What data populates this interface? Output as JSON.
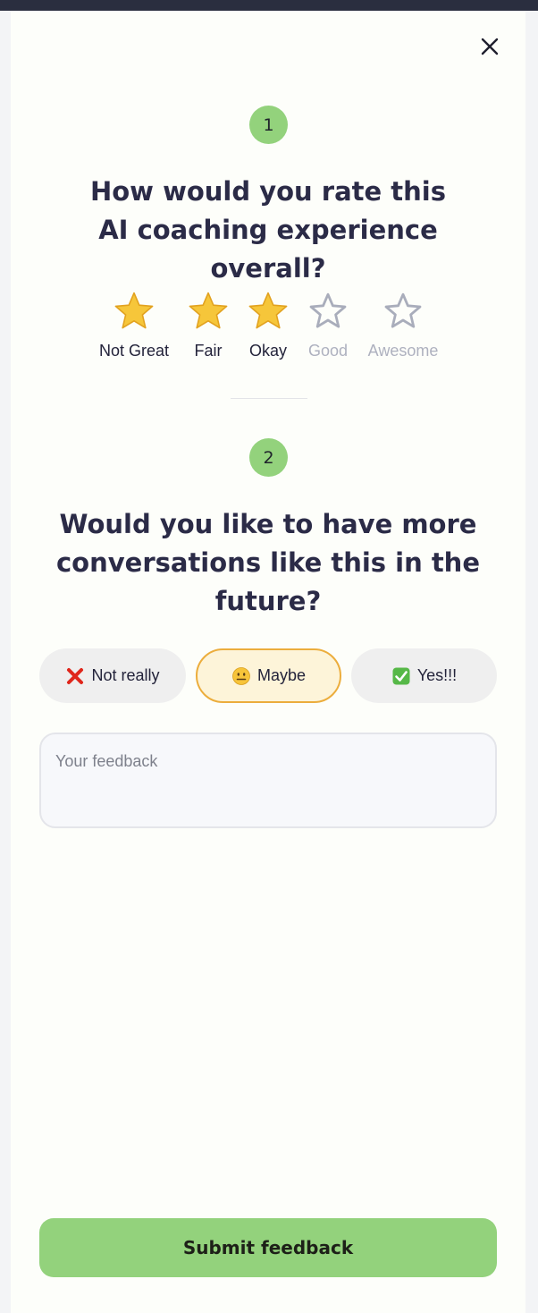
{
  "colors": {
    "accent_green": "#93d27c",
    "selected_border": "#ecad3c",
    "selected_bg": "#fdf4d9",
    "star_filled": "#f6c63a",
    "star_empty": "#a9adbb",
    "title_text": "#2b2b47"
  },
  "dialog": {
    "close_icon": "close-icon"
  },
  "question1": {
    "step": "1",
    "title_line1": "How would you rate this",
    "title_line2": "AI coaching experience overall?",
    "rating_value": 3,
    "rating_max": 5,
    "stars": [
      {
        "label": "Not Great",
        "filled": true
      },
      {
        "label": "Fair",
        "filled": true
      },
      {
        "label": "Okay",
        "filled": true
      },
      {
        "label": "Good",
        "filled": false
      },
      {
        "label": "Awesome",
        "filled": false
      }
    ]
  },
  "question2": {
    "step": "2",
    "title_line1": "Would you like to have more",
    "title_line2": "conversations like this in the",
    "title_line3": "future?",
    "selected": "Maybe",
    "options": [
      {
        "label": "Not really",
        "icon": "cross-mark-icon"
      },
      {
        "label": "Maybe",
        "icon": "neutral-face-icon"
      },
      {
        "label": "Yes!!!",
        "icon": "check-mark-icon"
      }
    ]
  },
  "feedback": {
    "placeholder": "Your feedback",
    "value": ""
  },
  "submit": {
    "label": "Submit feedback"
  }
}
